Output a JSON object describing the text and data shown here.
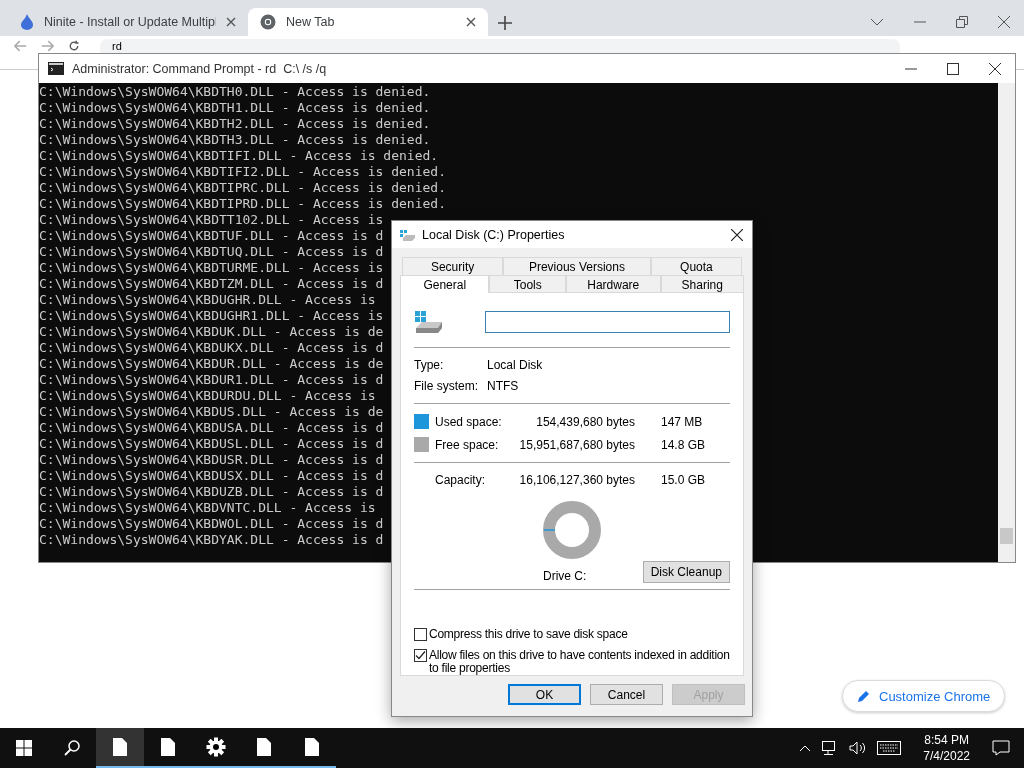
{
  "browser": {
    "tabs": [
      {
        "title": "Ninite - Install or Update Multipl",
        "kind": "ninite",
        "selected": false
      },
      {
        "title": "New Tab",
        "kind": "chrome",
        "selected": true
      }
    ],
    "omnibox": {
      "value": "rd"
    },
    "customize_button": "Customize Chrome"
  },
  "console": {
    "title": "Administrator: Command Prompt - rd  C:\\ /s /q",
    "lines": [
      "C:\\Windows\\SysWOW64\\KBDTH0.DLL - Access is denied.",
      "C:\\Windows\\SysWOW64\\KBDTH1.DLL - Access is denied.",
      "C:\\Windows\\SysWOW64\\KBDTH2.DLL - Access is denied.",
      "C:\\Windows\\SysWOW64\\KBDTH3.DLL - Access is denied.",
      "C:\\Windows\\SysWOW64\\KBDTIFI.DLL - Access is denied.",
      "C:\\Windows\\SysWOW64\\KBDTIFI2.DLL - Access is denied.",
      "C:\\Windows\\SysWOW64\\KBDTIPRC.DLL - Access is denied.",
      "C:\\Windows\\SysWOW64\\KBDTIPRD.DLL - Access is denied.",
      "C:\\Windows\\SysWOW64\\KBDTT102.DLL - Access is",
      "C:\\Windows\\SysWOW64\\KBDTUF.DLL - Access is d",
      "C:\\Windows\\SysWOW64\\KBDTUQ.DLL - Access is d",
      "C:\\Windows\\SysWOW64\\KBDTURME.DLL - Access is",
      "C:\\Windows\\SysWOW64\\KBDTZM.DLL - Access is d",
      "C:\\Windows\\SysWOW64\\KBDUGHR.DLL - Access is",
      "C:\\Windows\\SysWOW64\\KBDUGHR1.DLL - Access is",
      "C:\\Windows\\SysWOW64\\KBDUK.DLL - Access is de",
      "C:\\Windows\\SysWOW64\\KBDUKX.DLL - Access is d",
      "C:\\Windows\\SysWOW64\\KBDUR.DLL - Access is de",
      "C:\\Windows\\SysWOW64\\KBDUR1.DLL - Access is d",
      "C:\\Windows\\SysWOW64\\KBDURDU.DLL - Access is",
      "C:\\Windows\\SysWOW64\\KBDUS.DLL - Access is de",
      "C:\\Windows\\SysWOW64\\KBDUSA.DLL - Access is d",
      "C:\\Windows\\SysWOW64\\KBDUSL.DLL - Access is d",
      "C:\\Windows\\SysWOW64\\KBDUSR.DLL - Access is d",
      "C:\\Windows\\SysWOW64\\KBDUSX.DLL - Access is d",
      "C:\\Windows\\SysWOW64\\KBDUZB.DLL - Access is d",
      "C:\\Windows\\SysWOW64\\KBDVNTC.DLL - Access is",
      "C:\\Windows\\SysWOW64\\KBDWOL.DLL - Access is d",
      "C:\\Windows\\SysWOW64\\KBDYAK.DLL - Access is d"
    ]
  },
  "dialog": {
    "title": "Local Disk (C:) Properties",
    "tab_rows": [
      [
        {
          "label": "Security",
          "selected": false
        },
        {
          "label": "Previous Versions",
          "selected": false
        },
        {
          "label": "Quota",
          "selected": false
        }
      ],
      [
        {
          "label": "General",
          "selected": true
        },
        {
          "label": "Tools",
          "selected": false
        },
        {
          "label": "Hardware",
          "selected": false
        },
        {
          "label": "Sharing",
          "selected": false
        }
      ]
    ],
    "info": [
      {
        "label": "Type:",
        "value": "Local Disk"
      },
      {
        "label": "File system:",
        "value": "NTFS"
      }
    ],
    "space": [
      {
        "label": "Used space:",
        "bytes": "154,439,680 bytes",
        "size": "147 MB",
        "color": "#1e96dc"
      },
      {
        "label": "Free space:",
        "bytes": "15,951,687,680 bytes",
        "size": "14.8 GB",
        "color": "#a9a9a9"
      }
    ],
    "capacity": {
      "label": "Capacity:",
      "bytes": "16,106,127,360 bytes",
      "size": "15.0 GB"
    },
    "drive_label": "Drive C:",
    "cleanup_button": "Disk Cleanup",
    "options": [
      {
        "label": "Compress this drive to save disk space",
        "checked": false
      },
      {
        "label": "Allow files on this drive to have contents indexed in addition to file properties",
        "checked": true
      }
    ],
    "buttons": [
      {
        "label": "OK",
        "kind": "default",
        "disabled": false
      },
      {
        "label": "Cancel",
        "kind": "normal",
        "disabled": false
      },
      {
        "label": "Apply",
        "kind": "normal",
        "disabled": true
      }
    ]
  },
  "taskbar": {
    "apps": [
      {
        "kind": "document",
        "selected": true
      },
      {
        "kind": "document",
        "selected": false
      },
      {
        "kind": "settings",
        "selected": false
      },
      {
        "kind": "document",
        "selected": false
      },
      {
        "kind": "document",
        "selected": false
      }
    ],
    "time": "8:54 PM",
    "date": "7/4/2022"
  }
}
